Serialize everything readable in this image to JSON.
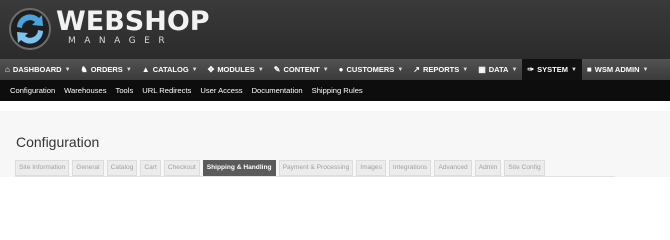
{
  "header": {
    "logo_main": "WEBSHOP",
    "logo_sub": "MANAGER"
  },
  "main_nav": [
    {
      "icon": "home-icon",
      "glyph": "⌂",
      "label": "DASHBOARD"
    },
    {
      "icon": "orders-icon",
      "glyph": "♞",
      "label": "ORDERS"
    },
    {
      "icon": "catalog-icon",
      "glyph": "▲",
      "label": "CATALOG"
    },
    {
      "icon": "modules-icon",
      "glyph": "✥",
      "label": "MODULES"
    },
    {
      "icon": "content-icon",
      "glyph": "✎",
      "label": "CONTENT"
    },
    {
      "icon": "customers-icon",
      "glyph": "●",
      "label": "CUSTOMERS"
    },
    {
      "icon": "reports-icon",
      "glyph": "↗",
      "label": "REPORTS"
    },
    {
      "icon": "data-icon",
      "glyph": "▦",
      "label": "DATA"
    },
    {
      "icon": "wrench-icon",
      "glyph": "✑",
      "label": "SYSTEM"
    },
    {
      "icon": "lock-icon",
      "glyph": "■",
      "label": "WSM ADMIN"
    }
  ],
  "sub_nav": [
    "Configuration",
    "Warehouses",
    "Tools",
    "URL Redirects",
    "User Access",
    "Documentation",
    "Shipping Rules"
  ],
  "page": {
    "title": "Configuration"
  },
  "tabs": [
    "Site Information",
    "General",
    "Catalog",
    "Cart",
    "Checkout",
    "Shipping & Handling",
    "Payment & Processing",
    "Images",
    "Integrations",
    "Advanced",
    "Admin",
    "Site Config"
  ],
  "active_tab": "Shipping & Handling",
  "active_nav": "SYSTEM",
  "colors": {
    "header_bg": "#2f2f2f",
    "nav_bg": "#444444",
    "subnav_bg": "#0d0d0d",
    "active_tab_bg": "#5b5b5b",
    "logo_blue": "#4aa3df"
  }
}
